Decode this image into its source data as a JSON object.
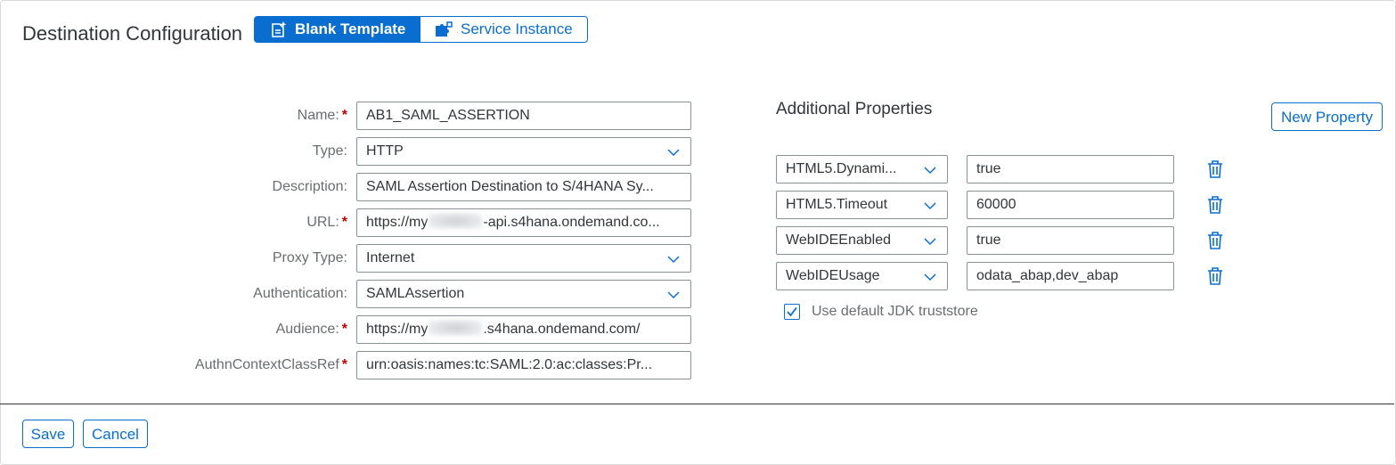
{
  "header": {
    "title": "Destination Configuration",
    "segments": [
      {
        "label": "Blank Template",
        "selected": true,
        "icon": "blank-template-icon"
      },
      {
        "label": "Service Instance",
        "selected": false,
        "icon": "service-instance-icon"
      }
    ]
  },
  "form": {
    "name": {
      "label": "Name:",
      "value": "AB1_SAML_ASSERTION",
      "required": true
    },
    "type": {
      "label": "Type:",
      "value": "HTTP"
    },
    "description": {
      "label": "Description:",
      "value": "SAML Assertion Destination to S/4HANA Sy..."
    },
    "url": {
      "label": "URL:",
      "value_prefix": "https://my",
      "value_suffix": "-api.s4hana.ondemand.co...",
      "required": true
    },
    "proxy_type": {
      "label": "Proxy Type:",
      "value": "Internet"
    },
    "authentication": {
      "label": "Authentication:",
      "value": "SAMLAssertion"
    },
    "audience": {
      "label": "Audience:",
      "value_prefix": "https://my",
      "value_suffix": ".s4hana.ondemand.com/",
      "required": true
    },
    "authn_context": {
      "label": "AuthnContextClassRef",
      "value": "urn:oasis:names:tc:SAML:2.0:ac:classes:Pr...",
      "required": true
    },
    "required_marker": "*"
  },
  "additional_properties": {
    "title": "Additional Properties",
    "new_property_label": "New Property",
    "properties": [
      {
        "key": "HTML5.Dynami...",
        "value": "true"
      },
      {
        "key": "HTML5.Timeout",
        "value": "60000"
      },
      {
        "key": "WebIDEEnabled",
        "value": "true"
      },
      {
        "key": "WebIDEUsage",
        "value": "odata_abap,dev_abap"
      }
    ],
    "use_jdk_truststore": {
      "label": "Use default JDK truststore",
      "checked": true
    }
  },
  "footer": {
    "save_label": "Save",
    "cancel_label": "Cancel"
  },
  "colors": {
    "accent": "#0a6ed1",
    "required": "#bb0000",
    "text": "#32363a",
    "label": "#6a6d70"
  }
}
